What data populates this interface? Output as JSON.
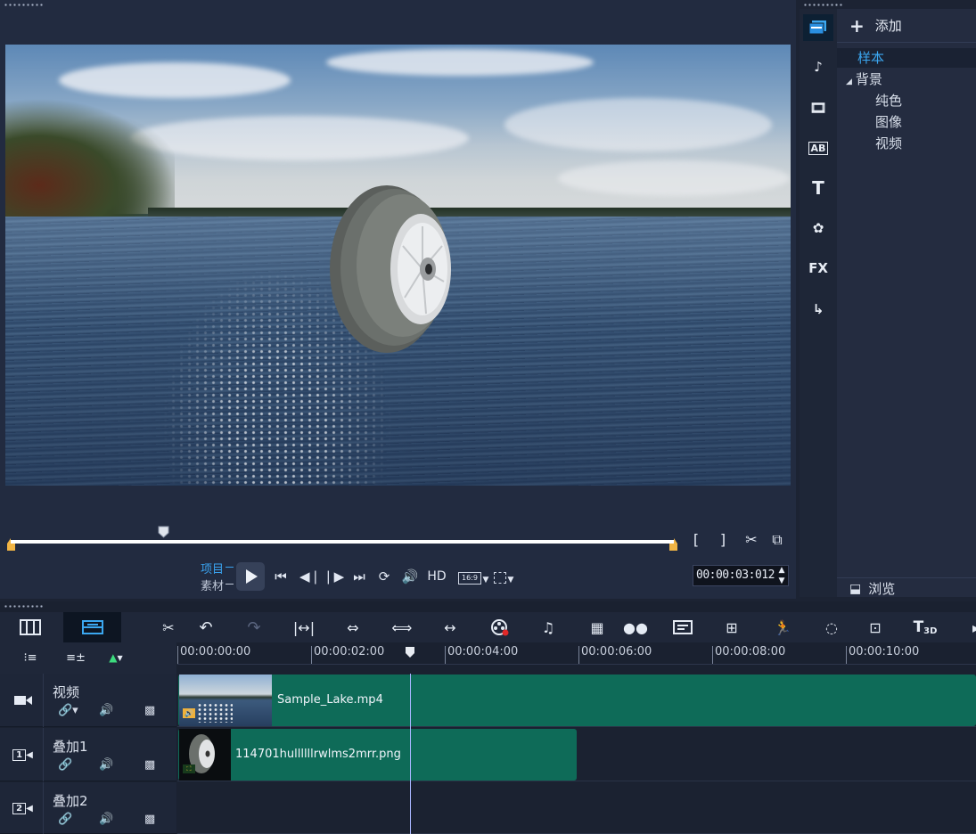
{
  "player": {
    "mode_project": "项目",
    "mode_clip": "素材",
    "hd_label": "HD",
    "aspect_label": "16:9",
    "timecode": "00:00:03:012",
    "playhead_progress": 0.23
  },
  "library": {
    "add_label": "添加",
    "tree": [
      {
        "label": "样本",
        "selected": true
      },
      {
        "label": "背景",
        "expanded": true
      },
      {
        "label": "纯色"
      },
      {
        "label": "图像"
      },
      {
        "label": "视频"
      }
    ],
    "browse_label": "浏览",
    "tabs": [
      "media-icon",
      "audio-icon",
      "instant-project-icon",
      "transition-icon",
      "title-icon",
      "graphics-icon",
      "filter-icon",
      "path-icon"
    ],
    "fx_label": "FX",
    "title_label": "T"
  },
  "timeline": {
    "ruler": [
      "00:00:00:00",
      "00:00:02:00",
      "00:00:04:00",
      "00:00:06:00",
      "00:00:08:00",
      "00:00:10:00"
    ],
    "tracks": [
      {
        "name": "视频",
        "badge": "▶■",
        "clip": "Sample_Lake.mp4"
      },
      {
        "name": "叠加1",
        "badge": "1",
        "clip": "114701hullllllrwlms2mrr.png"
      },
      {
        "name": "叠加2",
        "badge": "2",
        "clip": ""
      }
    ],
    "title3d_label": "T3D"
  },
  "colors": {
    "accent": "#3aa3ef",
    "clip": "#0e6b58",
    "panel": "#222b40"
  }
}
